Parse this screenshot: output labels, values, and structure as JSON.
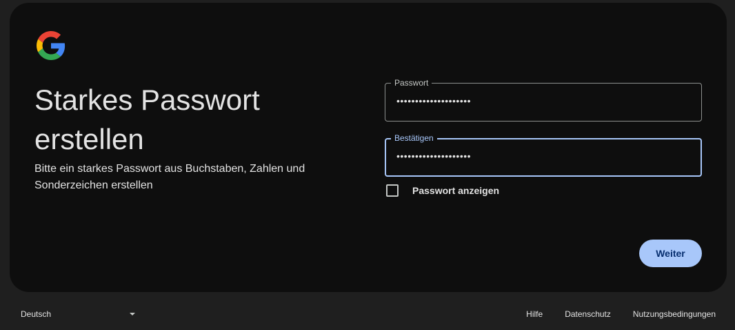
{
  "logo": {
    "icon": "google-g-icon",
    "colors": [
      "#4285F4",
      "#EA4335",
      "#FBBC05",
      "#34A853"
    ]
  },
  "heading": {
    "title": "Starkes Passwort erstellen",
    "subtitle": "Bitte ein starkes Passwort aus Buchstaben, Zahlen und Sonderzeichen erstellen"
  },
  "form": {
    "password_label": "Passwort",
    "password_value": "••••••••••••••••••••",
    "confirm_label": "Bestätigen",
    "confirm_value": "••••••••••••••••••••",
    "show_password_label": "Passwort anzeigen",
    "show_password_checked": false,
    "next_label": "Weiter"
  },
  "footer": {
    "language": "Deutsch",
    "links": [
      "Hilfe",
      "Datenschutz",
      "Nutzungsbedingungen"
    ]
  },
  "colors": {
    "accent": "#a8c7fa",
    "card_bg": "#0e0e0e",
    "page_bg": "#1f1f1f"
  }
}
